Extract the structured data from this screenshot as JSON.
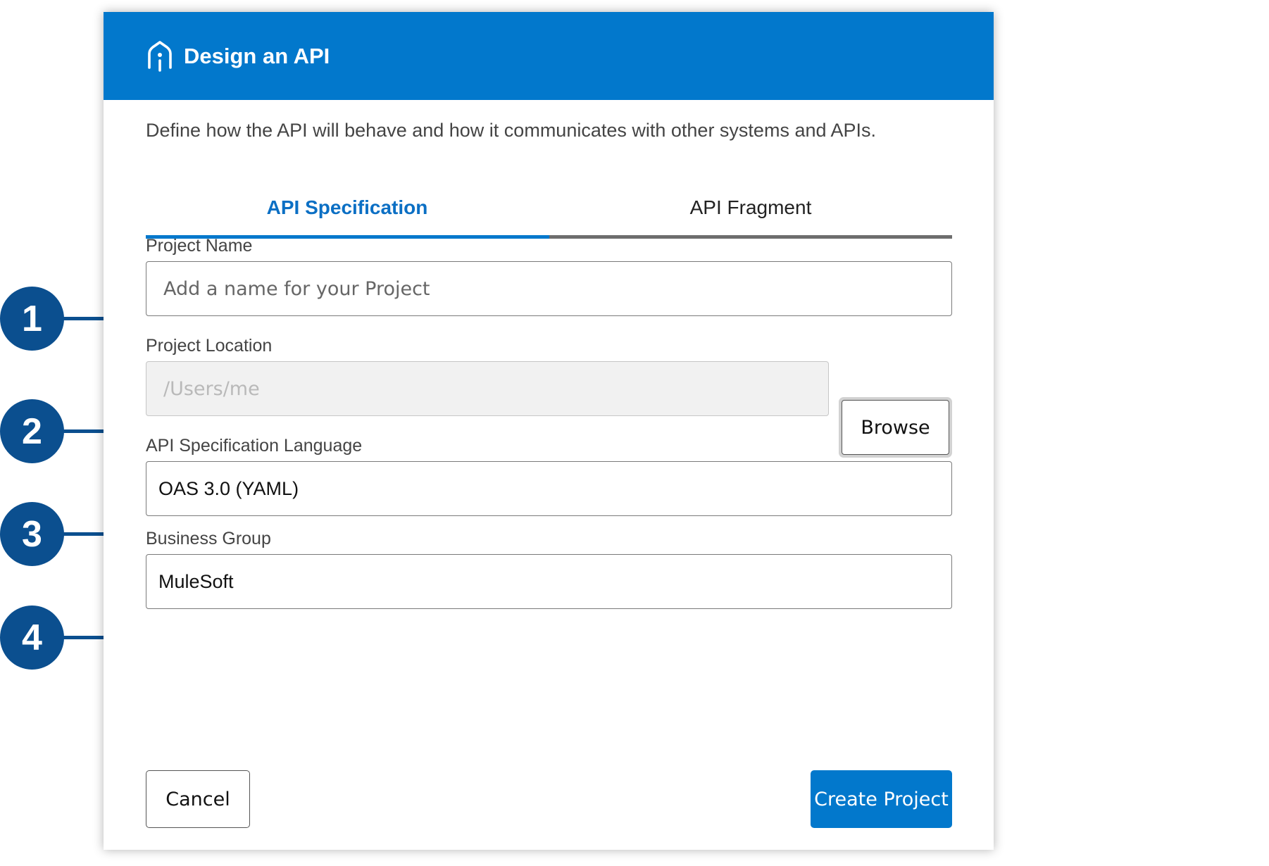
{
  "dialog": {
    "title": "Design an API",
    "description": "Define how the API will behave and how it communicates with other systems and APIs."
  },
  "tabs": [
    {
      "label": "API Specification",
      "active": true
    },
    {
      "label": "API Fragment",
      "active": false
    }
  ],
  "form": {
    "project_name": {
      "label": "Project Name",
      "placeholder": "Add a name for your Project",
      "value": ""
    },
    "project_location": {
      "label": "Project Location",
      "placeholder": "/Users/me",
      "value": "",
      "disabled": true,
      "browse_label": "Browse"
    },
    "spec_language": {
      "label": "API Specification Language",
      "value": "OAS 3.0 (YAML)"
    },
    "business_group": {
      "label": "Business Group",
      "value": "MuleSoft"
    }
  },
  "footer": {
    "cancel_label": "Cancel",
    "create_label": "Create Project"
  },
  "callouts": [
    "1",
    "2",
    "3",
    "4"
  ],
  "colors": {
    "header_bg": "#0278cc",
    "primary_button": "#0278cc",
    "active_tab_text": "#0b6fc4",
    "callout_badge": "#0b4f8f"
  },
  "icons": {
    "header_icon": "design-center-icon"
  }
}
